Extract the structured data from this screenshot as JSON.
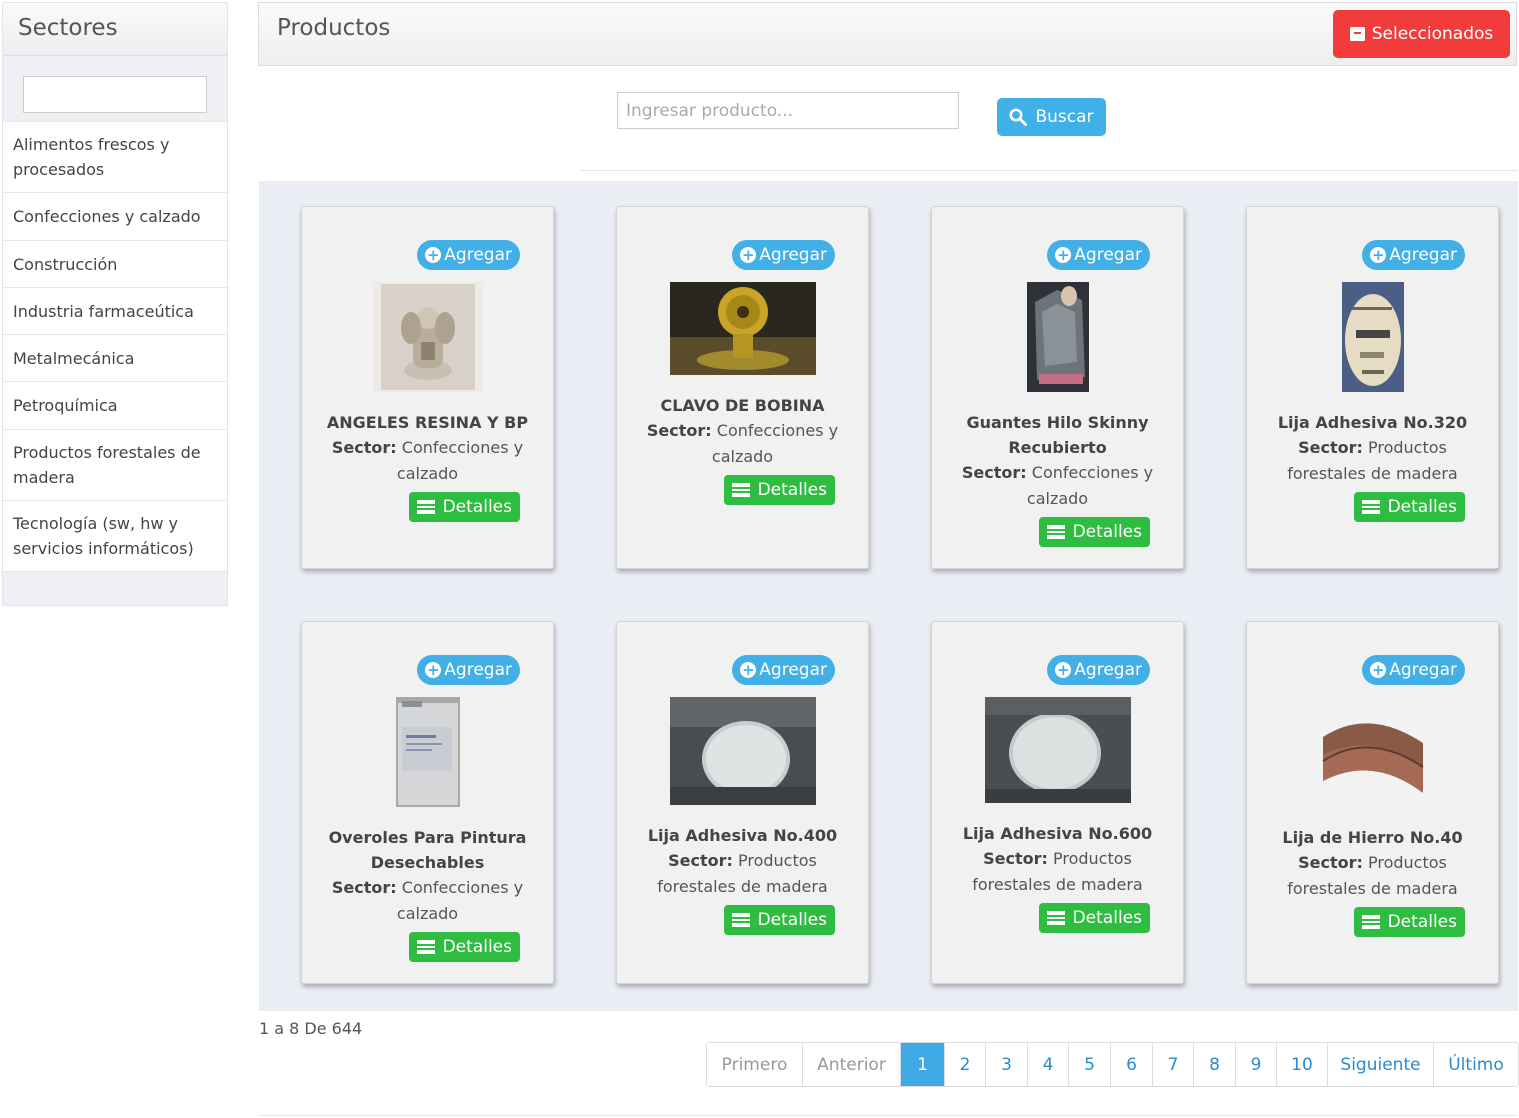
{
  "sidebar": {
    "title": "Sectores",
    "filter_value": "",
    "items": [
      {
        "label": "Alimentos frescos y procesados"
      },
      {
        "label": "Confecciones y calzado"
      },
      {
        "label": "Construcción"
      },
      {
        "label": "Industria farmaceútica"
      },
      {
        "label": "Metalmecánica"
      },
      {
        "label": "Petroquímica"
      },
      {
        "label": "Productos forestales de madera"
      },
      {
        "label": "Tecnología (sw, hw y servicios informáticos)"
      }
    ]
  },
  "header": {
    "title": "Productos",
    "selected_button": "Seleccionados",
    "selected_icon": "box-icon"
  },
  "search": {
    "placeholder": "Ingresar producto...",
    "value": "",
    "button_label": "Buscar",
    "button_icon": "search-icon"
  },
  "products": [
    {
      "name": "ANGELES RESINA Y BP",
      "sector_label": "Sector:",
      "sector": "Confecciones y calzado",
      "add_label": "Agregar",
      "details_label": "Detalles"
    },
    {
      "name": "CLAVO DE BOBINA",
      "sector_label": "Sector:",
      "sector": "Confecciones y calzado",
      "add_label": "Agregar",
      "details_label": "Detalles"
    },
    {
      "name": "Guantes Hilo Skinny Recubierto",
      "sector_label": "Sector:",
      "sector": "Confecciones y calzado",
      "add_label": "Agregar",
      "details_label": "Detalles"
    },
    {
      "name": "Lija Adhesiva No.320",
      "sector_label": "Sector:",
      "sector": "Productos forestales de madera",
      "add_label": "Agregar",
      "details_label": "Detalles"
    },
    {
      "name": "Overoles Para Pintura Desechables",
      "sector_label": "Sector:",
      "sector": "Confecciones y calzado",
      "add_label": "Agregar",
      "details_label": "Detalles"
    },
    {
      "name": "Lija Adhesiva No.400",
      "sector_label": "Sector:",
      "sector": "Productos forestales de madera",
      "add_label": "Agregar",
      "details_label": "Detalles"
    },
    {
      "name": "Lija Adhesiva No.600",
      "sector_label": "Sector:",
      "sector": "Productos forestales de madera",
      "add_label": "Agregar",
      "details_label": "Detalles"
    },
    {
      "name": "Lija de Hierro No.40",
      "sector_label": "Sector:",
      "sector": "Productos forestales de madera",
      "add_label": "Agregar",
      "details_label": "Detalles"
    }
  ],
  "pagination": {
    "summary": "1 a 8 De 644",
    "first": "Primero",
    "prev": "Anterior",
    "pages": [
      "1",
      "2",
      "3",
      "4",
      "5",
      "6",
      "7",
      "8",
      "9",
      "10"
    ],
    "active_page": "1",
    "next": "Siguiente",
    "last": "Último"
  },
  "colors": {
    "accent_blue": "#3fb0e8",
    "details_green": "#2ebd40",
    "selected_red": "#f23c3c",
    "grid_background": "#eaeef4"
  }
}
